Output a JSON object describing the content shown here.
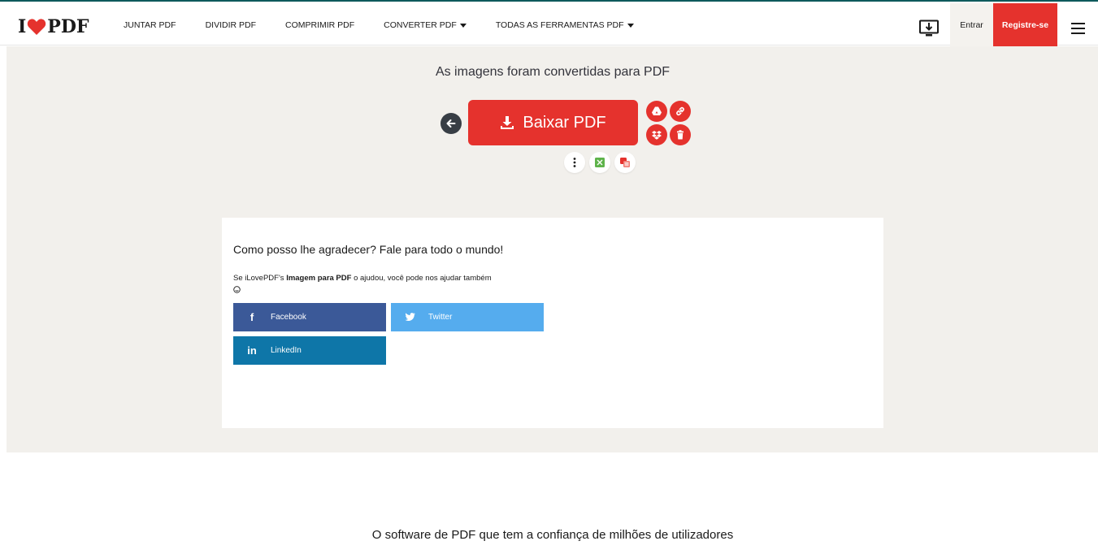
{
  "header": {
    "logo": {
      "prefix": "I",
      "suffix": "PDF"
    },
    "nav": [
      {
        "label": "JUNTAR PDF",
        "dropdown": false
      },
      {
        "label": "DIVIDIR PDF",
        "dropdown": false
      },
      {
        "label": "COMPRIMIR PDF",
        "dropdown": false
      },
      {
        "label": "CONVERTER PDF",
        "dropdown": true
      },
      {
        "label": "TODAS AS FERRAMENTAS PDF",
        "dropdown": true
      }
    ],
    "login_label": "Entrar",
    "register_label": "Registre-se"
  },
  "result": {
    "title": "As imagens foram convertidas para PDF",
    "download_label": "Baixar PDF"
  },
  "share": {
    "title": "Como posso lhe agradecer? Fale para todo o mundo!",
    "text_prefix": "Se iLovePDF's ",
    "text_tool": "Imagem para PDF",
    "text_suffix": " o ajudou, você pode nos ajudar também",
    "buttons": {
      "facebook": "Facebook",
      "twitter": "Twitter",
      "linkedin": "LinkedIn"
    }
  },
  "footer": {
    "title": "O software de PDF que tem a confiança de milhões de utilizadores"
  },
  "colors": {
    "brand_red": "#e5322d",
    "band_bg": "#f2f0ec",
    "facebook": "#3b5998",
    "twitter": "#55acee",
    "linkedin": "#0e76a8"
  }
}
